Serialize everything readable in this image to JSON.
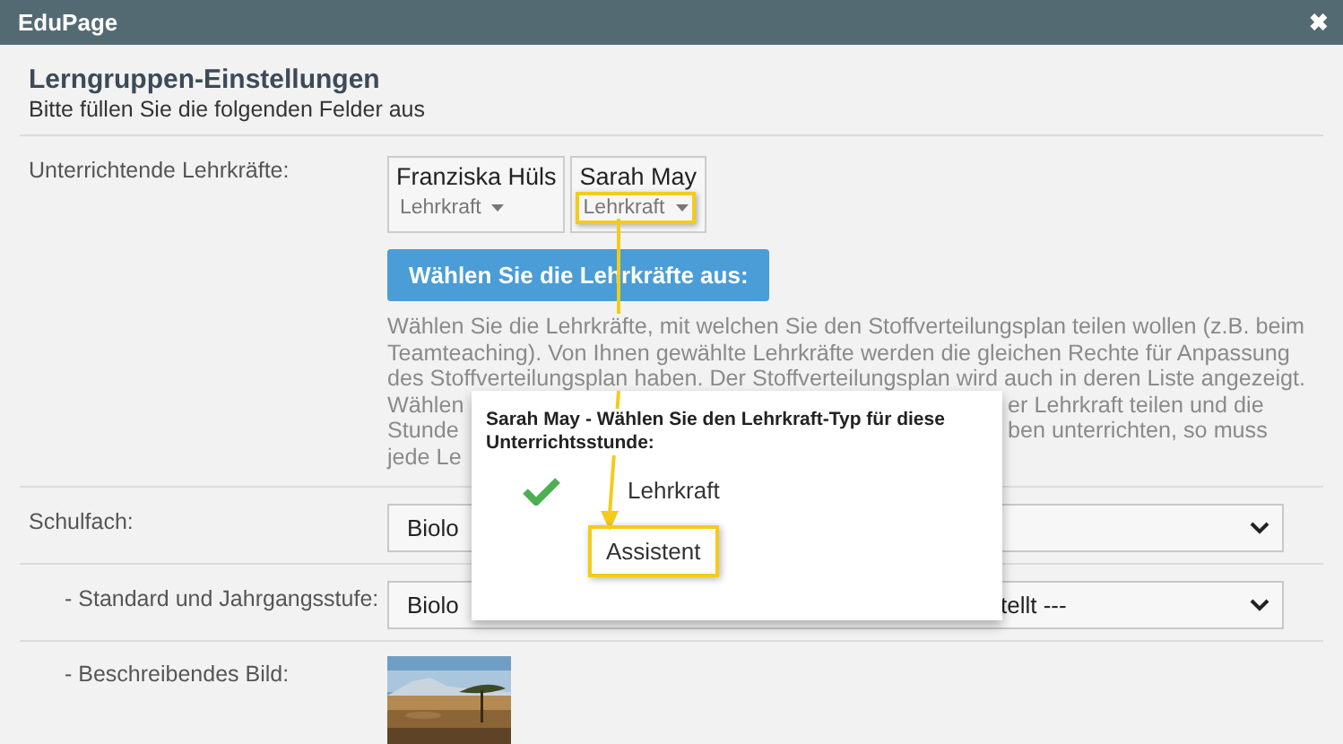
{
  "window": {
    "title": "EduPage",
    "close": "✖"
  },
  "header": {
    "title": "Lerngruppen-Einstellungen",
    "subtitle": "Bitte füllen Sie die folgenden Felder aus"
  },
  "teachers_row": {
    "label": "Unterrichtende Lehrkräfte:",
    "teachers": [
      {
        "name": "Franziska Hüls",
        "role": "Lehrkraft",
        "highlighted": false
      },
      {
        "name": "Sarah May",
        "role": "Lehrkraft",
        "highlighted": true
      }
    ],
    "button": "Wählen Sie die Lehrkräfte aus:",
    "description": [
      {
        "text": "Wählen Sie die Lehrkräfte, mit welchen Sie den Stoffverteilungsplan teilen wollen (z.B. beim"
      },
      {
        "text": "Teamteaching). Von Ihnen gewählte Lehrkräfte werden die gleichen Rechte für Anpassung"
      },
      {
        "text": "des Stoffverteilungsplan haben. Der Stoffverteilungsplan wird auch in deren Liste angezeigt."
      },
      {
        "left": "Wählen",
        "right": "er Lehrkraft teilen und die"
      },
      {
        "left": "Stunde",
        "right": "ben unterrichten, so muss"
      },
      {
        "left": "jede Le"
      }
    ]
  },
  "fields": [
    {
      "label": "Schulfach:",
      "kind": "main",
      "value_left": "Biolo"
    },
    {
      "label": "- Standard und Jahrgangsstufe:",
      "kind": "sub",
      "value_left": "Biolo",
      "value_right": "tellt ---"
    }
  ],
  "image_row": {
    "label": "- Beschreibendes Bild:",
    "kind": "picture"
  },
  "popup": {
    "title": "Sarah May - Wählen Sie den Lehrkraft-Typ für diese Unterrichtsstunde:",
    "options": [
      {
        "label": "Lehrkraft",
        "selected": true,
        "highlighted": false
      },
      {
        "label": "Assistent",
        "selected": false,
        "highlighted": true
      }
    ]
  }
}
